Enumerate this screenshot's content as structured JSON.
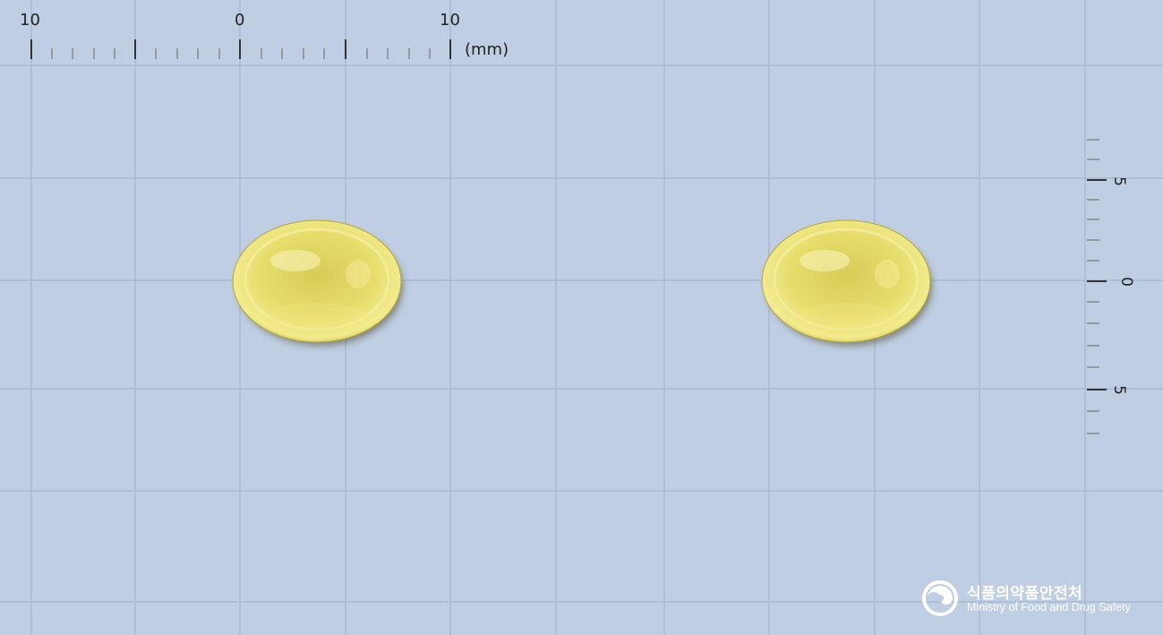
{
  "ruler_top": {
    "labels": [
      "10",
      "0",
      "10"
    ],
    "unit": "(mm)"
  },
  "ruler_right": {
    "labels": [
      "5",
      "0",
      "5"
    ]
  },
  "pills": [
    {
      "color": "#e6d95a",
      "shape": "oval soft capsule"
    },
    {
      "color": "#e6d95a",
      "shape": "oval soft capsule"
    }
  ],
  "logo": {
    "korean": "식품의약품안전처",
    "english": "Ministry of Food and Drug Safety",
    "icon": "mfds-emblem-icon"
  }
}
